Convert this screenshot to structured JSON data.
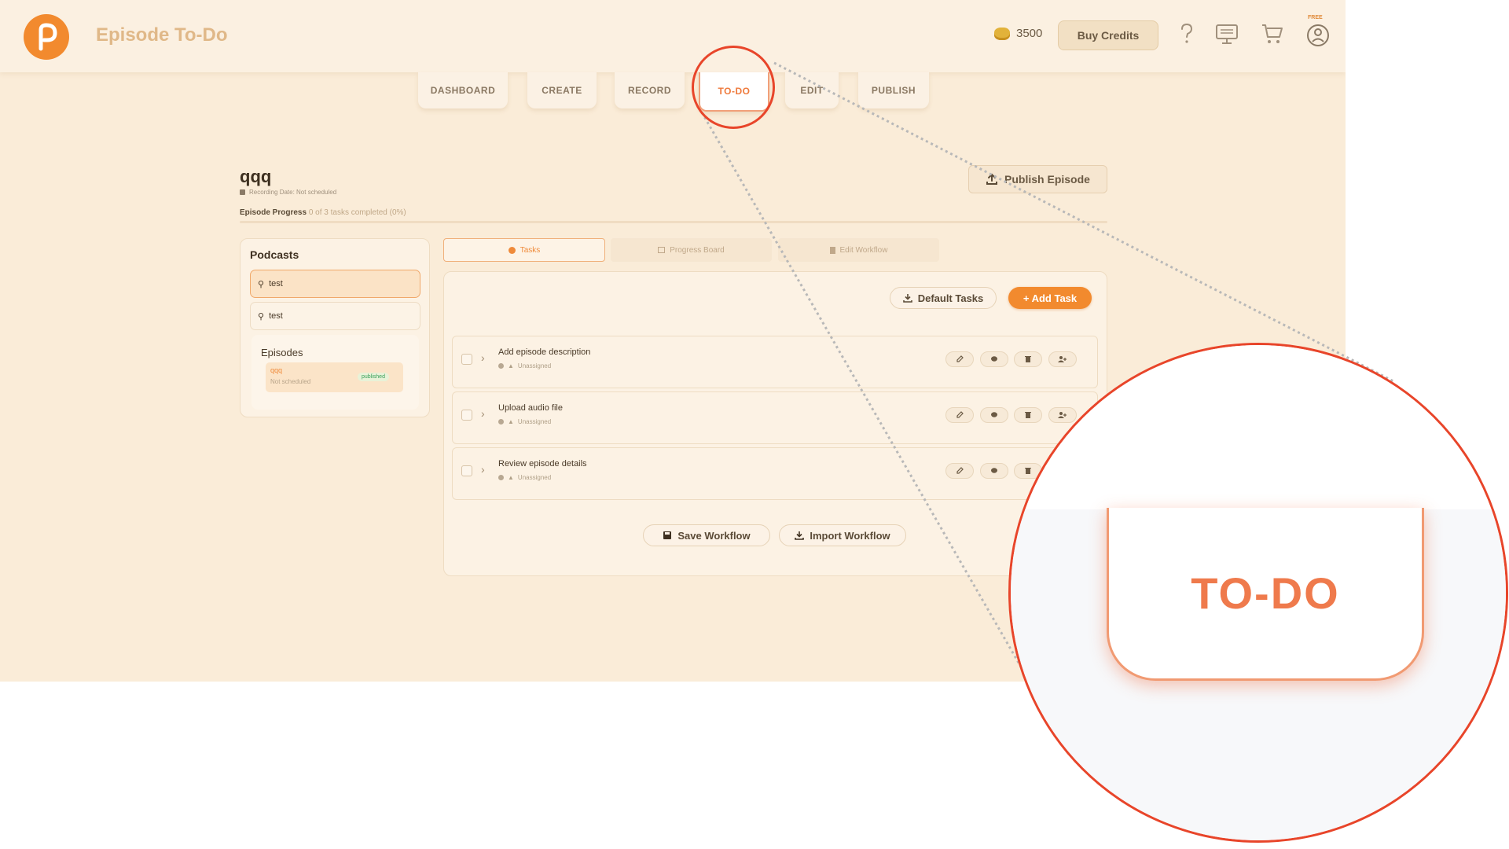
{
  "header": {
    "app_title": "Episode To-Do",
    "credits": "3500",
    "buy_credits": "Buy Credits",
    "plan_badge": "FREE",
    "icons": [
      "help-icon",
      "presentation-icon",
      "cart-icon",
      "user-account-icon"
    ]
  },
  "nav": {
    "tabs": [
      {
        "label": "DASHBOARD"
      },
      {
        "label": "CREATE"
      },
      {
        "label": "RECORD"
      },
      {
        "label": "TO-DO"
      },
      {
        "label": "EDIT"
      },
      {
        "label": "PUBLISH"
      }
    ],
    "active": "TO-DO"
  },
  "episode": {
    "title": "qqq",
    "recording_date": "Recording Date: Not scheduled",
    "progress_label": "Episode Progress",
    "progress_detail": "0 of 3 tasks completed (0%)",
    "progress_fraction": 0,
    "publish_button": "Publish Episode"
  },
  "sidebar": {
    "title": "Podcasts",
    "podcasts": [
      {
        "name": "test"
      },
      {
        "name": "test"
      }
    ],
    "episodes_title": "Episodes",
    "episodes": [
      {
        "name": "qqq",
        "date": "Not scheduled",
        "status": "published"
      }
    ]
  },
  "subtabs": [
    {
      "label": "Tasks"
    },
    {
      "label": "Progress Board"
    },
    {
      "label": "Edit Workflow"
    }
  ],
  "tasks_panel": {
    "default_tasks": "Default Tasks",
    "add_task": "+ Add Task",
    "save_workflow": "Save Workflow",
    "import_workflow": "Import Workflow",
    "tasks": [
      {
        "name": "Add episode description",
        "assignee": "Unassigned"
      },
      {
        "name": "Upload audio file",
        "assignee": "Unassigned"
      },
      {
        "name": "Review episode details",
        "assignee": "Unassigned"
      }
    ]
  },
  "zoom": {
    "label": "TO-DO"
  },
  "colors": {
    "accent": "#f28a2e",
    "active_tab_text": "#ef7a3c",
    "callout": "#e8452a",
    "background": "#faecd8"
  }
}
